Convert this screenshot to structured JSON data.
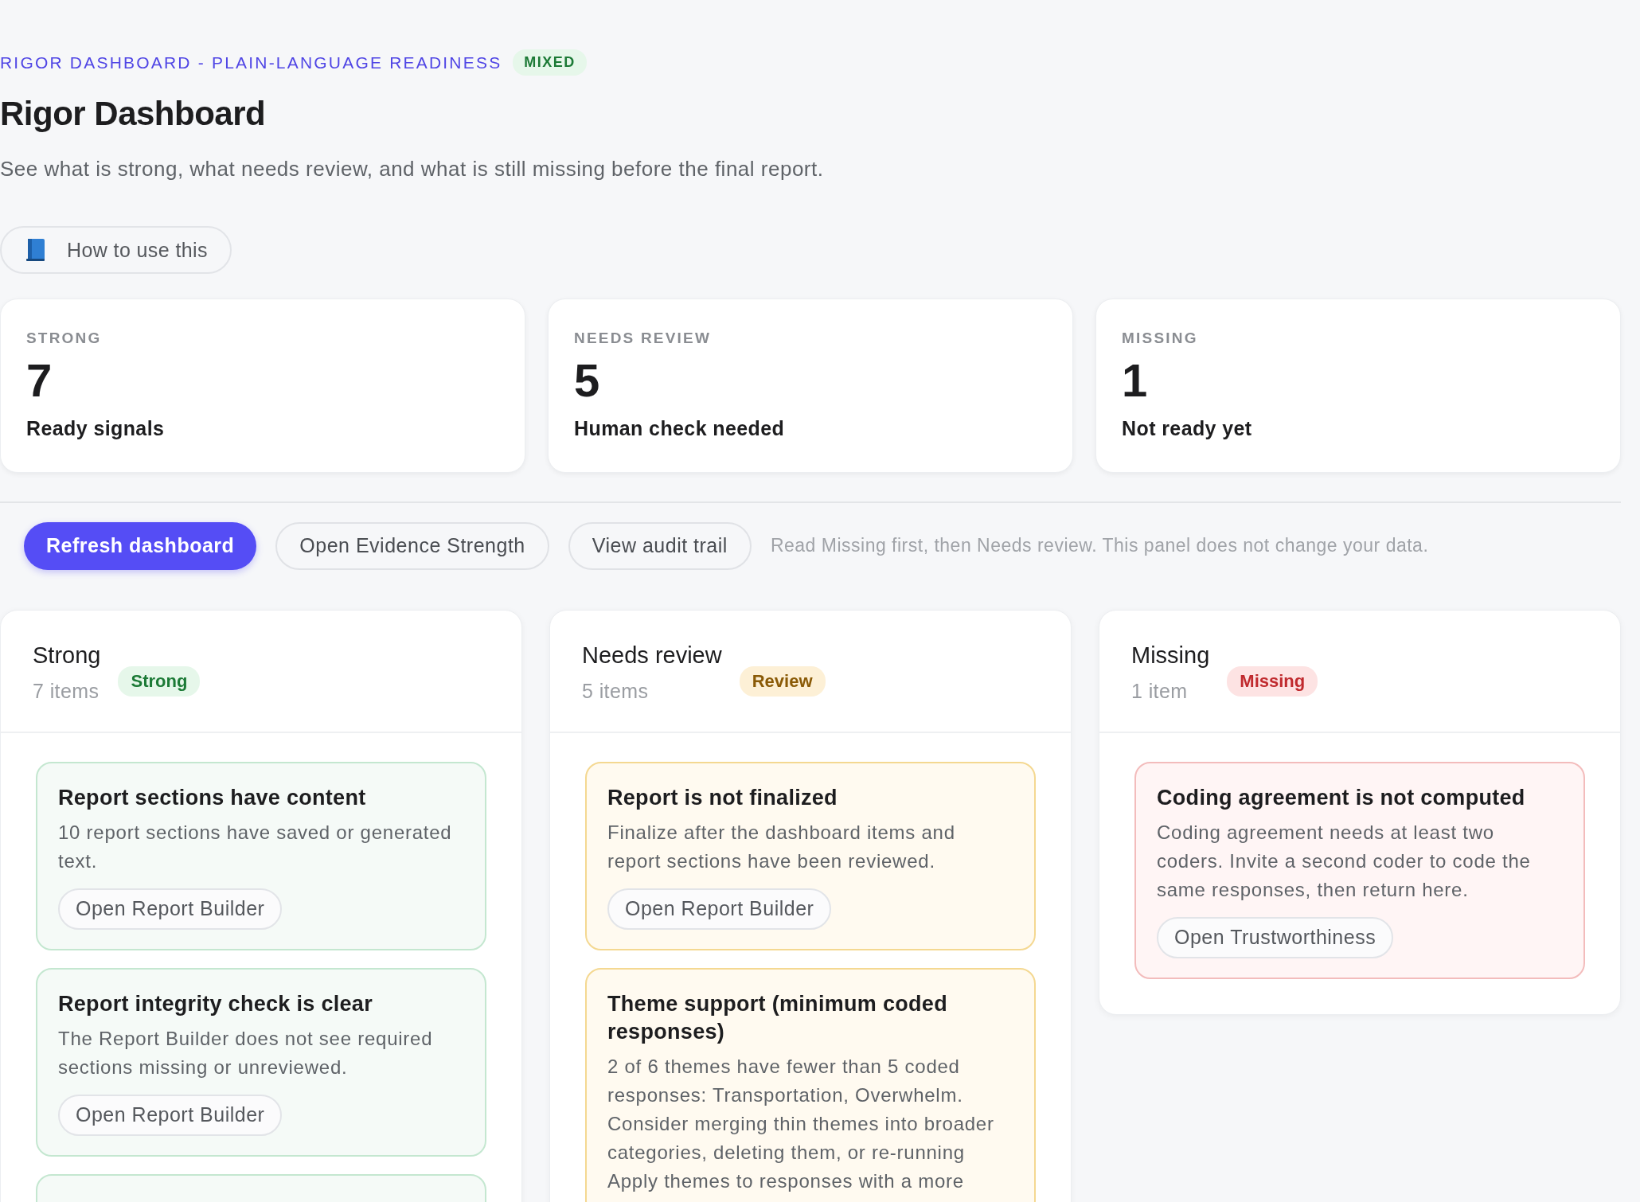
{
  "eyebrow": "RIGOR DASHBOARD - PLAIN-LANGUAGE READINESS",
  "status_badge": "MIXED",
  "title": "Rigor Dashboard",
  "subtitle": "See what is strong, what needs review, and what is still missing before the final report.",
  "help_button": {
    "label": "How to use this"
  },
  "stats": [
    {
      "label": "STRONG",
      "value": "7",
      "caption": "Ready signals"
    },
    {
      "label": "NEEDS REVIEW",
      "value": "5",
      "caption": "Human check needed"
    },
    {
      "label": "MISSING",
      "value": "1",
      "caption": "Not ready yet"
    }
  ],
  "actions": [
    {
      "label": "Refresh dashboard",
      "kind": "primary"
    },
    {
      "label": "Open Evidence Strength",
      "kind": "secondary"
    },
    {
      "label": "View audit trail",
      "kind": "secondary"
    }
  ],
  "hint": "Read Missing first, then Needs review. This panel does not change your data.",
  "columns": [
    {
      "kind": "strong",
      "title": "Strong",
      "count": "7 items",
      "badge": "Strong",
      "more_below": true,
      "items": [
        {
          "title": "Report sections have content",
          "text": "10 report sections have saved or generated text.",
          "action": "Open Report Builder"
        },
        {
          "title": "Report integrity check is clear",
          "text": "The Report Builder does not see required sections missing or unreviewed.",
          "action": "Open Report Builder"
        }
      ]
    },
    {
      "kind": "review",
      "title": "Needs review",
      "count": "5 items",
      "badge": "Review",
      "more_below": false,
      "items": [
        {
          "title": "Report is not finalized",
          "text": "Finalize after the dashboard items and report sections have been reviewed.",
          "action": "Open Report Builder"
        },
        {
          "title": "Theme support (minimum coded responses)",
          "text": "2 of 6 themes have fewer than 5 coded responses: Transportation, Overwhelm. Consider merging thin themes into broader categories, deleting them, or re-running Apply themes to responses with a more"
        }
      ]
    },
    {
      "kind": "missing",
      "title": "Missing",
      "count": "1 item",
      "badge": "Missing",
      "more_below": false,
      "items": [
        {
          "title": "Coding agreement is not computed",
          "text": "Coding agreement needs at least two coders. Invite a second coder to code the same responses, then return here.",
          "action": "Open Trustworthiness"
        }
      ]
    }
  ]
}
